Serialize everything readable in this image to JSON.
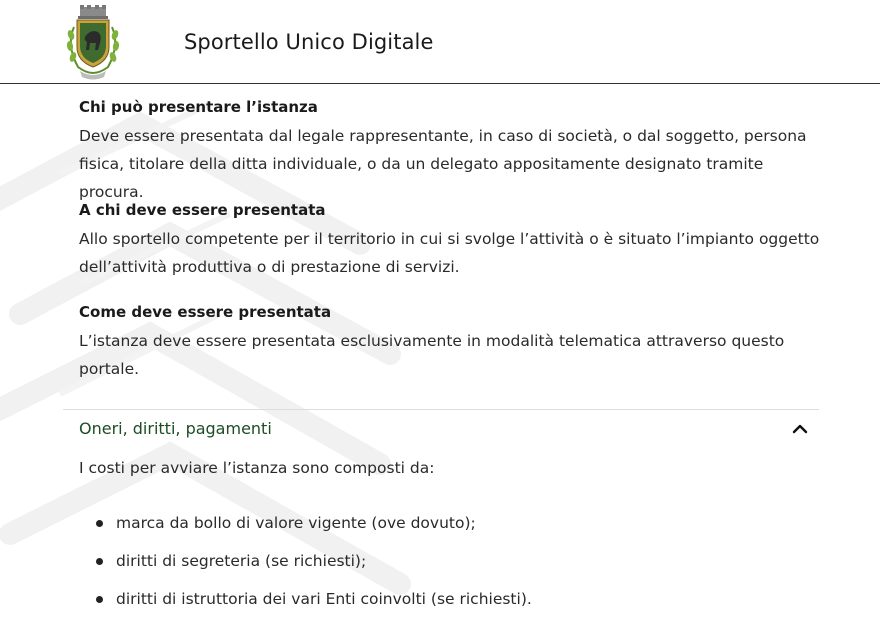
{
  "header": {
    "title": "Sportello Unico Digitale",
    "logo_icon": "coat-of-arms-icon"
  },
  "sections": [
    {
      "heading": "Chi può presentare l’istanza",
      "body": "Deve essere presentata dal legale rappresentante, in caso di società, o dal soggetto, persona fisica, titolare della ditta individuale, o da un delegato appositamente designato tramite procura."
    },
    {
      "heading": "A chi deve essere presentata",
      "body": "Allo sportello competente per il territorio in cui si svolge l’attività o è situato l’impianto oggetto dell’attività produttiva o di prestazione di servizi."
    },
    {
      "heading": "Come deve essere presentata",
      "body": "L’istanza deve essere presentata esclusivamente in modalità telematica attraverso questo portale."
    }
  ],
  "accordion": {
    "title": "Oneri, diritti, pagamenti",
    "icon": "chevron-up-icon",
    "expanded": true,
    "intro": "I costi per avviare l’istanza sono composti da:",
    "items": [
      "marca da bollo di valore vigente (ove dovuto);",
      "diritti di segreteria (se richiesti);",
      "diritti di istruttoria dei vari Enti coinvolti (se richiesti)."
    ]
  },
  "colors": {
    "accordion_title": "#1d4d25",
    "header_border": "#333333"
  }
}
